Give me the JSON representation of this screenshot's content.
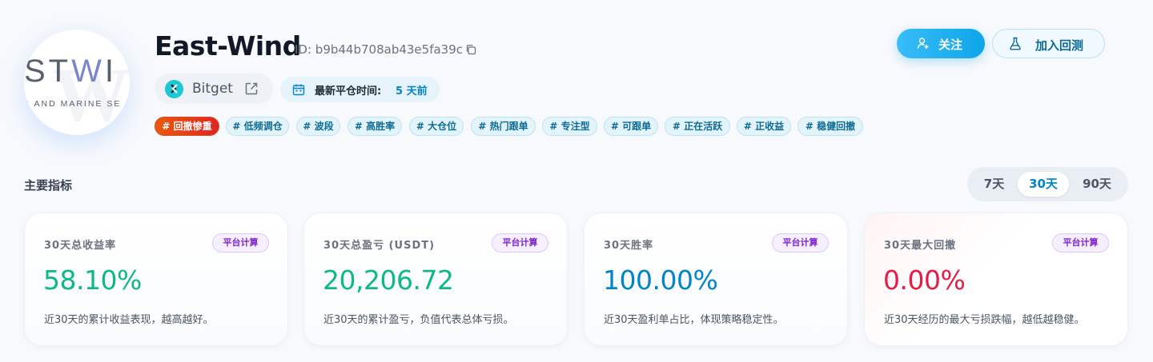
{
  "trader": {
    "name": "East-Wind",
    "id_text": "ID: b9b44b708ab43e5fa39c",
    "avatar_logo_main": "STWI",
    "avatar_logo_sub": "G AND MARINE SE"
  },
  "exchange": {
    "name": "Bitget"
  },
  "last_close": {
    "label": "最新平仓时间:",
    "value": "5 天前"
  },
  "tags": [
    "# 回撤惨重",
    "# 低频调仓",
    "# 波段",
    "# 高胜率",
    "# 大仓位",
    "# 热门跟单",
    "# 专注型",
    "# 可跟单",
    "# 正在活跃",
    "# 正收益",
    "# 稳健回撤"
  ],
  "actions": {
    "follow_label": "关注",
    "backtest_label": "加入回测"
  },
  "section": {
    "title": "主要指标"
  },
  "range": {
    "options": [
      "7天",
      "30天",
      "90天"
    ],
    "selected": "30天"
  },
  "metrics": [
    {
      "label": "30天总收益率",
      "badge": "平台计算",
      "value": "58.10%",
      "desc": "近30天的累计收益表现，越高越好。",
      "color": "#10b981"
    },
    {
      "label": "30天总盈亏 (USDT)",
      "badge": "平台计算",
      "value": "20,206.72",
      "desc": "近30天的累计盈亏，负值代表总体亏损。",
      "color": "#10b981"
    },
    {
      "label": "30天胜率",
      "badge": "平台计算",
      "value": "100.00%",
      "desc": "近30天盈利单占比，体现策略稳定性。",
      "color": "#0284c7"
    },
    {
      "label": "30天最大回撤",
      "badge": "平台计算",
      "value": "0.00%",
      "desc": "近30天经历的最大亏损跌幅，越低越稳健。",
      "color": "#e11d48"
    }
  ],
  "colors": {
    "accent": "#0ea5e9",
    "positive": "#10b981",
    "negative": "#e11d48",
    "hot_tag": "#dc2626"
  }
}
